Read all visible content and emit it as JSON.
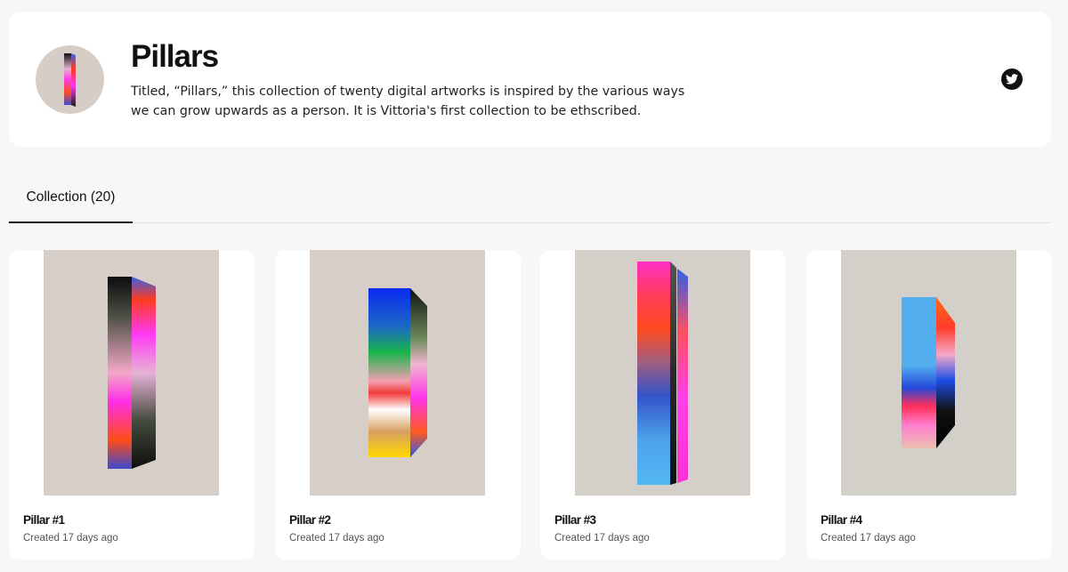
{
  "collection": {
    "title": "Pillars",
    "description": "Titled, “Pillars,” this collection of twenty digital artworks is inspired by the various ways we can grow upwards as a person. It is Vittoria's first collection to be ethscribed.",
    "social_icon": "twitter-icon"
  },
  "tabs": [
    {
      "label": "Collection (20)",
      "active": true
    }
  ],
  "items": [
    {
      "name": "Pillar #1",
      "created": "Created 17 days ago"
    },
    {
      "name": "Pillar #2",
      "created": "Created 17 days ago"
    },
    {
      "name": "Pillar #3",
      "created": "Created 17 days ago"
    },
    {
      "name": "Pillar #4",
      "created": "Created 17 days ago"
    }
  ],
  "colors": {
    "page_bg": "#f7f7f8",
    "card_bg": "#ffffff",
    "art_bg_warm": "#d7cfc7",
    "art_bg_cool": "#d3d0c9",
    "text": "#111111",
    "muted": "#555555"
  }
}
